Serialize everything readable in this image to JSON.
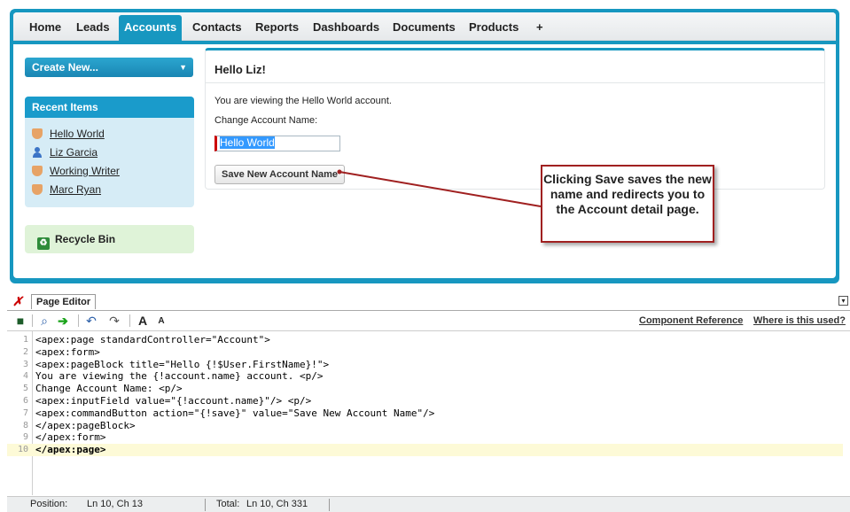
{
  "nav": {
    "tabs": [
      {
        "label": "Home"
      },
      {
        "label": "Leads"
      },
      {
        "label": "Accounts"
      },
      {
        "label": "Contacts"
      },
      {
        "label": "Reports"
      },
      {
        "label": "Dashboards"
      },
      {
        "label": "Documents"
      },
      {
        "label": "Products"
      },
      {
        "label": "+"
      }
    ],
    "active_tab": "Accounts"
  },
  "sidebar": {
    "create_new_label": "Create New...",
    "recent_items_title": "Recent Items",
    "recent_items": [
      {
        "label": "Hello World",
        "icon": "account-icon"
      },
      {
        "label": "Liz Garcia",
        "icon": "contact-icon"
      },
      {
        "label": "Working Writer",
        "icon": "account-icon"
      },
      {
        "label": "Marc Ryan",
        "icon": "account-icon"
      }
    ],
    "recycle_bin_label": "Recycle Bin"
  },
  "page_block": {
    "title": "Hello Liz!",
    "viewing_text": "You are viewing the Hello World account.",
    "change_label": "Change Account Name:",
    "input_value": "Hello World",
    "button_label": "Save New Account Name"
  },
  "callout": {
    "text": "Clicking Save saves the new name and redirects you to the Account detail page.",
    "border_color": "#a02020"
  },
  "editor": {
    "tab_label": "Page Editor",
    "links": {
      "component_reference": "Component Reference",
      "where_used": "Where is this used?"
    },
    "toolbar": {
      "font_larger": "A",
      "font_smaller": "A"
    },
    "code_lines": [
      {
        "n": "1",
        "text": "<apex:page standardController=\"Account\">"
      },
      {
        "n": "2",
        "text": "<apex:form>"
      },
      {
        "n": "3",
        "text": "<apex:pageBlock title=\"Hello {!$User.FirstName}!\">"
      },
      {
        "n": "4",
        "text": "You are viewing the {!account.name} account. <p/>"
      },
      {
        "n": "5",
        "text": "Change Account Name: <p/>"
      },
      {
        "n": "6",
        "text": "<apex:inputField value=\"{!account.name}\"/> <p/>"
      },
      {
        "n": "7",
        "text": "<apex:commandButton action=\"{!save}\" value=\"Save New Account Name\"/>"
      },
      {
        "n": "8",
        "text": "</apex:pageBlock>"
      },
      {
        "n": "9",
        "text": "</apex:form>"
      },
      {
        "n": "10",
        "text": "</apex:page>"
      }
    ],
    "status": {
      "position_label": "Position:",
      "position_value": "Ln 10, Ch 13",
      "total_label": "Total:",
      "total_value": "Ln 10, Ch 331"
    }
  },
  "colors": {
    "brand_blue": "#1797c0",
    "recent_bg": "#d6ecf6",
    "recycle_bg": "#dff3d8",
    "current_line": "#fdfad7"
  }
}
